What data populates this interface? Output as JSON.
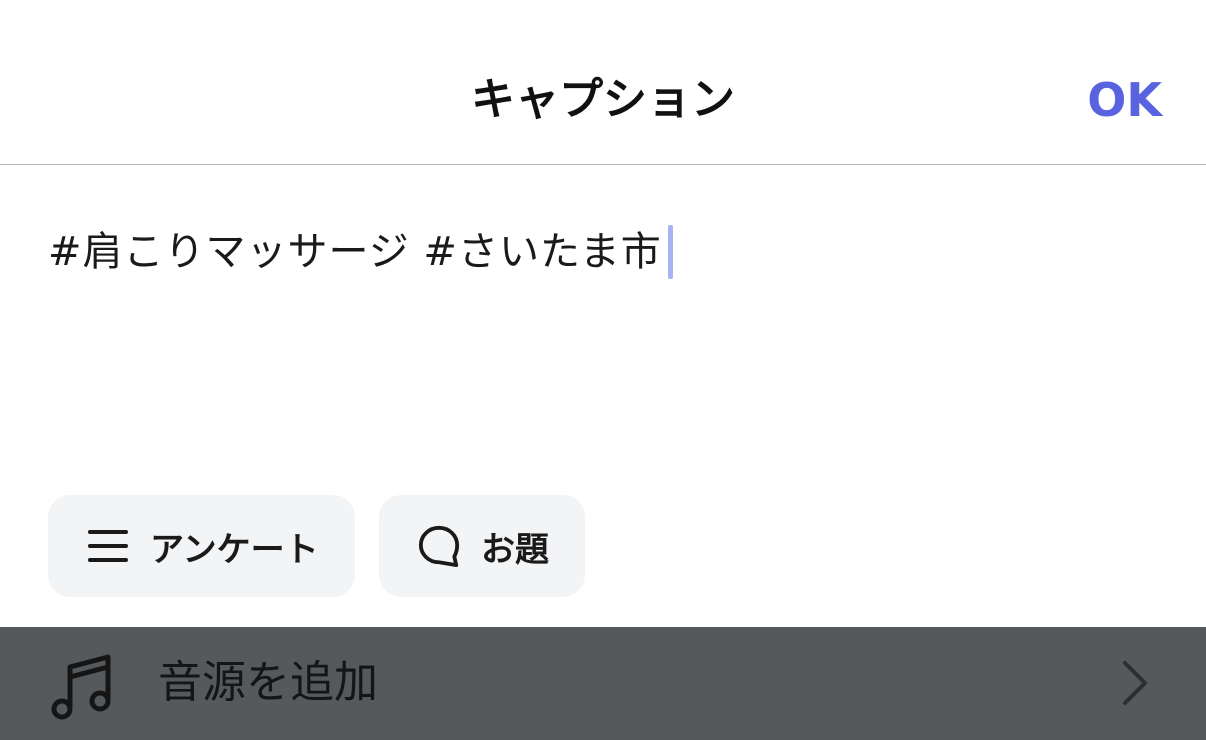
{
  "header": {
    "title": "キャプション",
    "ok_label": "OK"
  },
  "caption": {
    "text": "#肩こりマッサージ #さいたま市"
  },
  "chips": {
    "poll_label": "アンケート",
    "poll_icon": "list-icon",
    "topic_label": "お題",
    "topic_icon": "speech-bubble-icon"
  },
  "music": {
    "label": "音源を追加",
    "icon": "music-note-icon"
  },
  "colors": {
    "accent": "#5963e0",
    "cursor": "#a8b4f2",
    "chip_bg": "#f3f4f6",
    "music_bar_bg": "#56595c"
  }
}
